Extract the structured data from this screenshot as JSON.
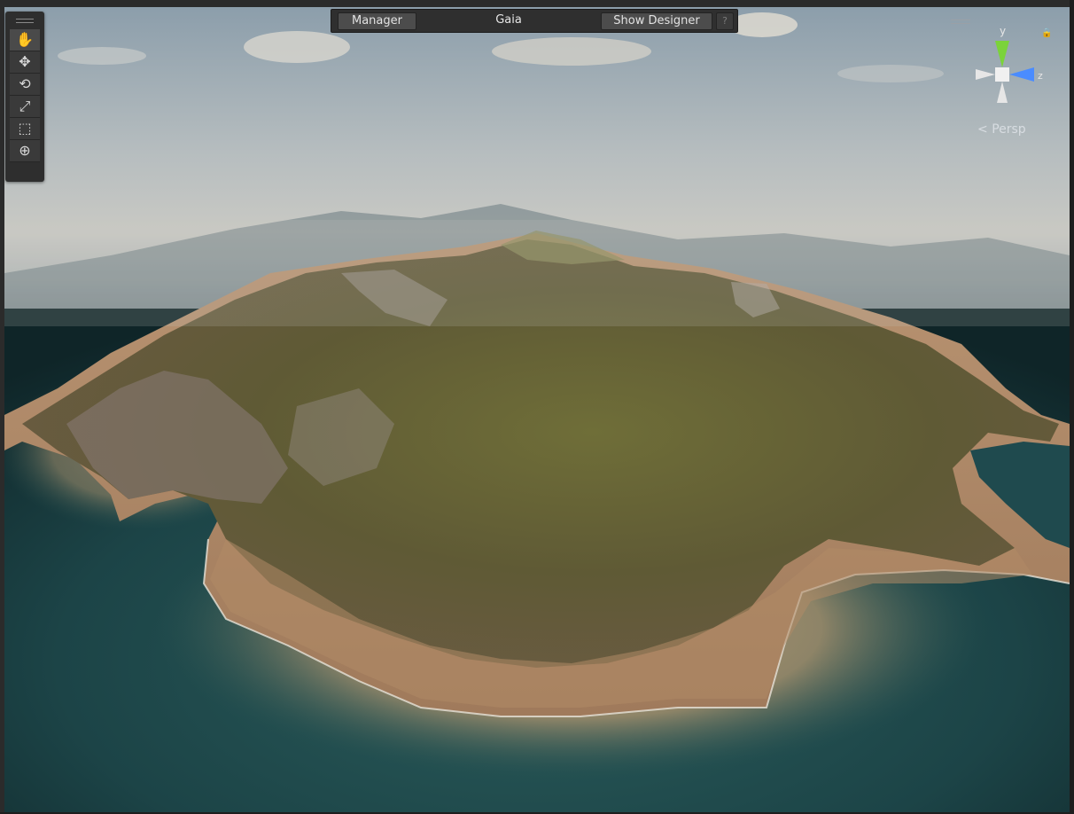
{
  "toolbar": {
    "manager_label": "Manager",
    "title": "Gaia",
    "show_designer_label": "Show Designer",
    "help_label": "?"
  },
  "tools": [
    {
      "name": "hand-tool",
      "icon": "hand-icon",
      "glyph": "✋"
    },
    {
      "name": "move-tool",
      "icon": "move-icon",
      "glyph": "✥"
    },
    {
      "name": "rotate-tool",
      "icon": "rotate-icon",
      "glyph": "⟲"
    },
    {
      "name": "scale-tool",
      "icon": "scale-icon",
      "glyph": "⤢"
    },
    {
      "name": "rect-tool",
      "icon": "rect-transform-icon",
      "glyph": "⬚"
    },
    {
      "name": "transform-tool",
      "icon": "transform-icon",
      "glyph": "⊕"
    }
  ],
  "gizmo": {
    "y_label": "y",
    "z_label": "z",
    "projection_label": "Persp",
    "projection_glyph": "<",
    "lock_glyph": "🔒",
    "colors": {
      "y_axis": "#7bd33a",
      "z_axis": "#4a8cff",
      "neutral": "#e6e6e6"
    }
  },
  "scene": {
    "sky_top": "#8fa0ad",
    "haze": "#c9c9c4",
    "sea": "#173c3f",
    "grass": "#6d6e3a",
    "sand": "#c19a73"
  }
}
